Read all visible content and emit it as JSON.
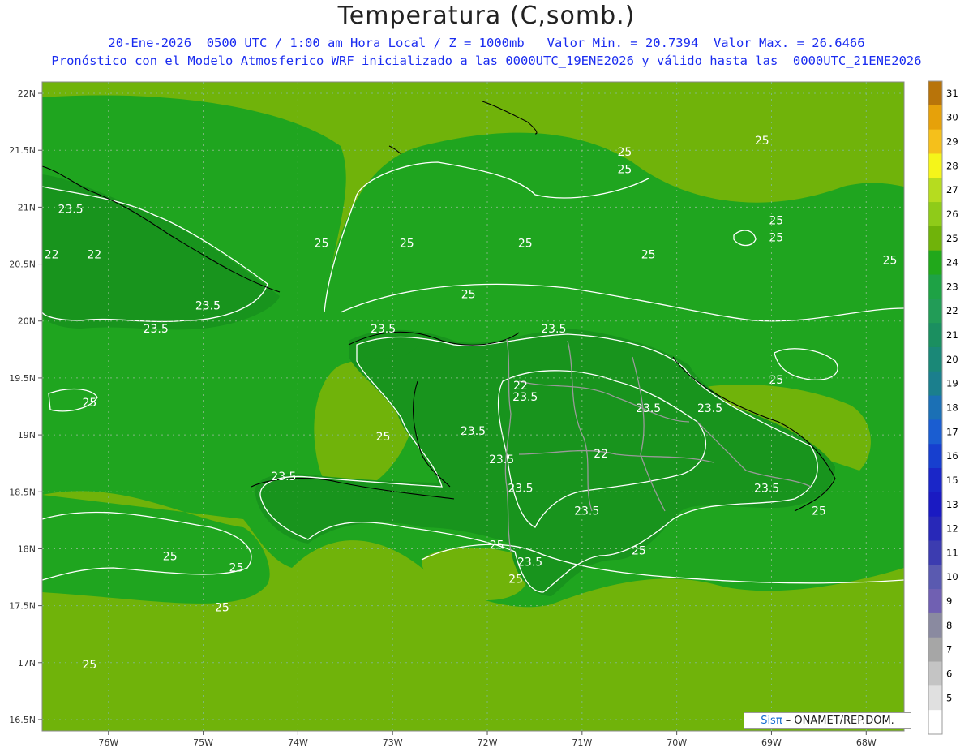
{
  "title": "Temperatura (C,somb.)",
  "subtitle1": "20-Ene-2026  0500 UTC / 1:00 am Hora Local / Z = 1000mb   Valor Min. = 20.7394  Valor Max. = 26.6466",
  "subtitle2": "Pronóstico con el Modelo Atmosferico WRF inicializado a las 0000UTC_19ENE2026 y válido hasta las  0000UTC_21ENE2026",
  "credit": {
    "brand": "Sisπ",
    "text": " – ONAMET/REP.DOM."
  },
  "map": {
    "lon_range": [
      -76.7,
      -67.6
    ],
    "lat_range": [
      16.4,
      22.1
    ],
    "lat_labels": [
      "22N",
      "21.5N",
      "21N",
      "20.5N",
      "20N",
      "19.5N",
      "19N",
      "18.5N",
      "18N",
      "17.5N",
      "17N",
      "16.5N"
    ],
    "lat_values": [
      22,
      21.5,
      21,
      20.5,
      20,
      19.5,
      19,
      18.5,
      18,
      17.5,
      17,
      16.5
    ],
    "lon_labels": [
      "76W",
      "75W",
      "74W",
      "73W",
      "72W",
      "71W",
      "70W",
      "69W",
      "68W"
    ],
    "lon_values": [
      -76,
      -75,
      -74,
      -73,
      -72,
      -71,
      -70,
      -69,
      -68
    ],
    "background_color": "#1fa51f",
    "land_color": "#18941d",
    "warm_color": "#70b30a"
  },
  "colorbar": {
    "levels": [
      "31",
      "30",
      "29",
      "28",
      "27",
      "26",
      "25",
      "24",
      "23",
      "22",
      "21",
      "20",
      "19",
      "18",
      "17",
      "16",
      "15",
      "13",
      "12",
      "11",
      "10",
      "9",
      "8",
      "7",
      "6",
      "5"
    ],
    "colors": [
      "#b8740a",
      "#e6a10a",
      "#f5c01b",
      "#f5f51a",
      "#b6dc1f",
      "#8fcb19",
      "#70b30a",
      "#21a81b",
      "#1ea245",
      "#229c57",
      "#1b8f60",
      "#1a8877",
      "#1b7f8d",
      "#1b70b5",
      "#1a5dd1",
      "#173fcf",
      "#1a26c8",
      "#1a1ac2",
      "#2828b8",
      "#3c3cb0",
      "#5a5ab0",
      "#7060b2",
      "#8a8aa0",
      "#a6a6a6",
      "#c4c4c4",
      "#e0e0e0",
      "#ffffff"
    ]
  },
  "contour_labels": [
    {
      "text": "23.5",
      "lon": -76.4,
      "lat": 20.95
    },
    {
      "text": "22",
      "lon": -76.6,
      "lat": 20.55
    },
    {
      "text": "22",
      "lon": -76.15,
      "lat": 20.55
    },
    {
      "text": "23.5",
      "lon": -74.95,
      "lat": 20.1
    },
    {
      "text": "23.5",
      "lon": -75.5,
      "lat": 19.9
    },
    {
      "text": "25",
      "lon": -73.75,
      "lat": 20.65
    },
    {
      "text": "25",
      "lon": -72.85,
      "lat": 20.65
    },
    {
      "text": "25",
      "lon": -71.6,
      "lat": 20.65
    },
    {
      "text": "25",
      "lon": -70.3,
      "lat": 20.55
    },
    {
      "text": "25",
      "lon": -70.55,
      "lat": 21.3
    },
    {
      "text": "25",
      "lon": -70.55,
      "lat": 21.45
    },
    {
      "text": "25",
      "lon": -69.1,
      "lat": 21.55
    },
    {
      "text": "25",
      "lon": -68.95,
      "lat": 20.85
    },
    {
      "text": "25",
      "lon": -68.95,
      "lat": 20.7
    },
    {
      "text": "25",
      "lon": -67.75,
      "lat": 20.5
    },
    {
      "text": "25",
      "lon": -72.2,
      "lat": 20.2
    },
    {
      "text": "23.5",
      "lon": -73.1,
      "lat": 19.9
    },
    {
      "text": "23.5",
      "lon": -71.3,
      "lat": 19.9
    },
    {
      "text": "22",
      "lon": -71.65,
      "lat": 19.4
    },
    {
      "text": "23.5",
      "lon": -71.6,
      "lat": 19.3
    },
    {
      "text": "23.5",
      "lon": -72.15,
      "lat": 19.0
    },
    {
      "text": "25",
      "lon": -73.1,
      "lat": 18.95
    },
    {
      "text": "23.5",
      "lon": -70.3,
      "lat": 19.2
    },
    {
      "text": "23.5",
      "lon": -69.65,
      "lat": 19.2
    },
    {
      "text": "22",
      "lon": -70.8,
      "lat": 18.8
    },
    {
      "text": "23.5",
      "lon": -71.85,
      "lat": 18.75
    },
    {
      "text": "23.5",
      "lon": -71.65,
      "lat": 18.5
    },
    {
      "text": "23.5",
      "lon": -74.15,
      "lat": 18.6
    },
    {
      "text": "23.5",
      "lon": -70.95,
      "lat": 18.3
    },
    {
      "text": "23.5",
      "lon": -69.05,
      "lat": 18.5
    },
    {
      "text": "25",
      "lon": -68.5,
      "lat": 18.3
    },
    {
      "text": "25",
      "lon": -71.9,
      "lat": 18.0
    },
    {
      "text": "23.5",
      "lon": -71.55,
      "lat": 17.85
    },
    {
      "text": "25",
      "lon": -71.7,
      "lat": 17.7
    },
    {
      "text": "25",
      "lon": -70.4,
      "lat": 17.95
    },
    {
      "text": "25",
      "lon": -76.2,
      "lat": 19.25
    },
    {
      "text": "25",
      "lon": -75.35,
      "lat": 17.9
    },
    {
      "text": "25",
      "lon": -74.65,
      "lat": 17.8
    },
    {
      "text": "25",
      "lon": -76.2,
      "lat": 16.95
    },
    {
      "text": "25",
      "lon": -74.8,
      "lat": 17.45
    },
    {
      "text": "25",
      "lon": -68.95,
      "lat": 19.45
    }
  ]
}
